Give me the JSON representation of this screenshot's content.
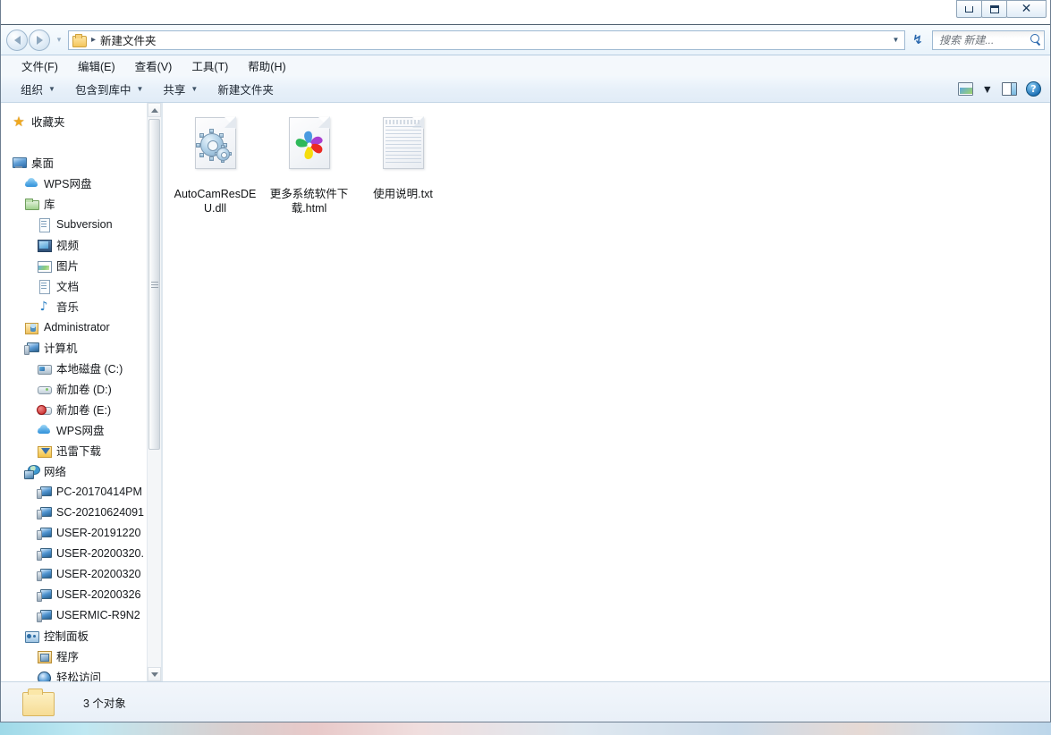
{
  "window": {
    "controls": {
      "minimize": "–",
      "maximize": "□",
      "close": "✕"
    }
  },
  "navbar": {
    "back_icon": "back-arrow-icon",
    "forward_icon": "forward-arrow-icon",
    "history_caret": "▾",
    "breadcrumb_separator": "▸",
    "breadcrumb": "新建文件夹",
    "address_dropdown": "▼",
    "refresh_icon": "↯",
    "search_placeholder": "搜索 新建...",
    "search_value": ""
  },
  "menubar": {
    "items": [
      {
        "label": "文件(F)"
      },
      {
        "label": "编辑(E)"
      },
      {
        "label": "查看(V)"
      },
      {
        "label": "工具(T)"
      },
      {
        "label": "帮助(H)"
      }
    ]
  },
  "toolbar": {
    "organize": "组织",
    "include_in_library": "包含到库中",
    "share": "共享",
    "new_folder": "新建文件夹",
    "caret": "▼",
    "view_dropdown_caret": "▼",
    "help_glyph": "?"
  },
  "sidebar": {
    "items": [
      {
        "label": "收藏夹",
        "icon": "star-icon",
        "level": 0,
        "gap_before": false
      },
      {
        "label": "桌面",
        "icon": "monitor-icon",
        "level": 0,
        "gap_before": true
      },
      {
        "label": "WPS网盘",
        "icon": "cloud-icon",
        "level": 1,
        "gap_before": false
      },
      {
        "label": "库",
        "icon": "library-folder-icon",
        "level": 1,
        "gap_before": false
      },
      {
        "label": "Subversion",
        "icon": "document-icon",
        "level": 2,
        "gap_before": false
      },
      {
        "label": "视频",
        "icon": "video-icon",
        "level": 2,
        "gap_before": false
      },
      {
        "label": "图片",
        "icon": "picture-icon",
        "level": 2,
        "gap_before": false
      },
      {
        "label": "文档",
        "icon": "document-icon",
        "level": 2,
        "gap_before": false
      },
      {
        "label": "音乐",
        "icon": "music-note-icon",
        "level": 2,
        "gap_before": false
      },
      {
        "label": "Administrator",
        "icon": "user-folder-icon",
        "level": 1,
        "gap_before": false
      },
      {
        "label": "计算机",
        "icon": "computer-icon",
        "level": 1,
        "gap_before": false
      },
      {
        "label": "本地磁盘 (C:)",
        "icon": "system-disk-icon",
        "level": 2,
        "gap_before": false
      },
      {
        "label": "新加卷 (D:)",
        "icon": "disk-icon",
        "level": 2,
        "gap_before": false
      },
      {
        "label": "新加卷 (E:)",
        "icon": "disk-error-icon",
        "level": 2,
        "gap_before": false
      },
      {
        "label": "WPS网盘",
        "icon": "cloud-icon",
        "level": 2,
        "gap_before": false
      },
      {
        "label": "迅雷下载",
        "icon": "thunder-folder-icon",
        "level": 2,
        "gap_before": false
      },
      {
        "label": "网络",
        "icon": "network-icon",
        "level": 1,
        "gap_before": false
      },
      {
        "label": "PC-20170414PM",
        "icon": "network-pc-icon",
        "level": 2,
        "gap_before": false
      },
      {
        "label": "SC-20210624091",
        "icon": "network-pc-icon",
        "level": 2,
        "gap_before": false
      },
      {
        "label": "USER-20191220",
        "icon": "network-pc-icon",
        "level": 2,
        "gap_before": false
      },
      {
        "label": "USER-20200320.",
        "icon": "network-pc-icon",
        "level": 2,
        "gap_before": false
      },
      {
        "label": "USER-20200320",
        "icon": "network-pc-icon",
        "level": 2,
        "gap_before": false
      },
      {
        "label": "USER-20200326",
        "icon": "network-pc-icon",
        "level": 2,
        "gap_before": false
      },
      {
        "label": "USERMIC-R9N2",
        "icon": "network-pc-icon",
        "level": 2,
        "gap_before": false
      },
      {
        "label": "控制面板",
        "icon": "control-panel-icon",
        "level": 1,
        "gap_before": false
      },
      {
        "label": "程序",
        "icon": "programs-icon",
        "level": 2,
        "gap_before": false
      },
      {
        "label": "轻松访问",
        "icon": "ease-of-access-icon",
        "level": 2,
        "gap_before": false
      }
    ]
  },
  "files": [
    {
      "name": "AutoCamResDEU.dll",
      "icon": "dll-gears-icon"
    },
    {
      "name": "更多系统软件下载.html",
      "icon": "html-pinwheel-icon"
    },
    {
      "name": "使用说明.txt",
      "icon": "text-notepad-icon"
    }
  ],
  "statusbar": {
    "text": "3 个对象",
    "icon": "folder-icon"
  },
  "colors": {
    "accent": "#2a68ae",
    "folder": "#f3c55c",
    "star": "#f0a81e",
    "pinwheel_purple": "#a93fd0",
    "pinwheel_red": "#ec2a22",
    "pinwheel_yellow": "#f5dd0d",
    "pinwheel_green": "#2fb95a",
    "pinwheel_blue": "#4a9ae0"
  }
}
